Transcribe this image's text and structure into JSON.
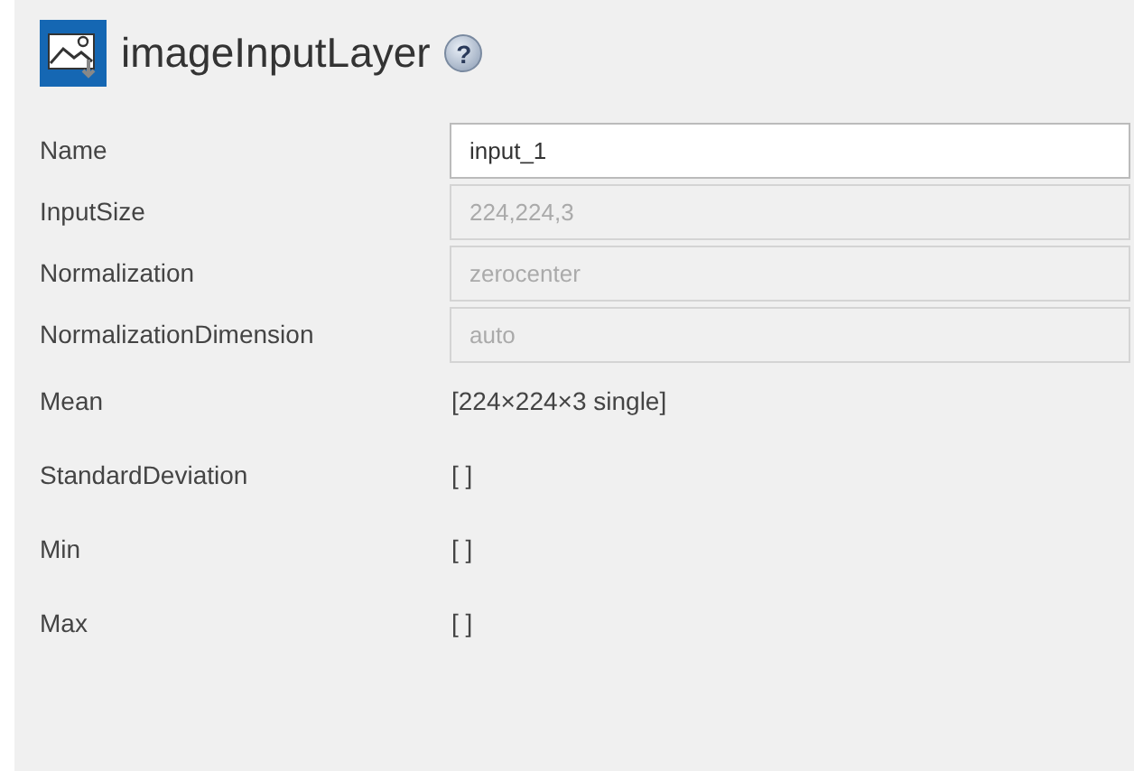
{
  "header": {
    "title": "imageInputLayer",
    "help": "?"
  },
  "properties": [
    {
      "label": "Name",
      "kind": "field",
      "value": "input_1",
      "disabled": false
    },
    {
      "label": "InputSize",
      "kind": "field",
      "value": "224,224,3",
      "disabled": true
    },
    {
      "label": "Normalization",
      "kind": "field",
      "value": "zerocenter",
      "disabled": true
    },
    {
      "label": "NormalizationDimension",
      "kind": "field",
      "value": "auto",
      "disabled": true
    },
    {
      "label": "Mean",
      "kind": "text",
      "value": "[224×224×3 single]"
    },
    {
      "label": "StandardDeviation",
      "kind": "text",
      "value": "[ ]"
    },
    {
      "label": "Min",
      "kind": "text",
      "value": "[ ]"
    },
    {
      "label": "Max",
      "kind": "text",
      "value": "[ ]"
    }
  ]
}
